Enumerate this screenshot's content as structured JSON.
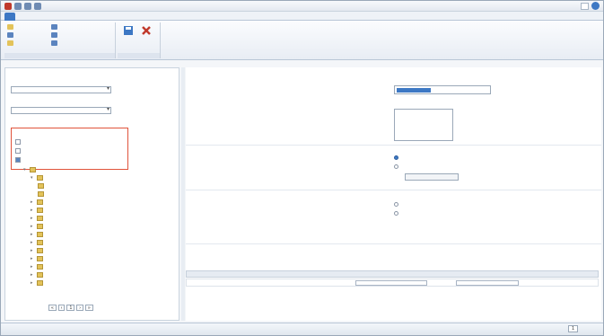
{
  "window": {
    "title": "",
    "user": ""
  },
  "tabs": [
    {
      "label": ""
    },
    {
      "label": ""
    },
    {
      "label": ""
    },
    {
      "label": ""
    },
    {
      "label": ""
    }
  ],
  "ribbon": {
    "group1": {
      "label": "",
      "items": [
        {
          "label": ""
        },
        {
          "label": ""
        },
        {
          "label": ""
        },
        {
          "label": ""
        },
        {
          "label": ""
        },
        {
          "label": ""
        }
      ]
    },
    "group2": {
      "label": "",
      "buttons": [
        {
          "label": ""
        },
        {
          "label": ""
        }
      ]
    }
  },
  "left": {
    "field1_label": "",
    "field1_value": "",
    "field2_label": "",
    "field2_value": "",
    "field2_link": "",
    "options_label": "",
    "options": [
      {
        "label": "",
        "checked": false
      },
      {
        "label": "",
        "checked": false
      },
      {
        "label": "",
        "checked": true
      }
    ],
    "tree": [
      {
        "label": ""
      },
      {
        "label": ""
      },
      {
        "label": ""
      },
      {
        "label": ""
      },
      {
        "label": ""
      },
      {
        "label": ""
      },
      {
        "label": ""
      },
      {
        "label": ""
      },
      {
        "label": ""
      },
      {
        "label": ""
      },
      {
        "label": ""
      },
      {
        "label": ""
      },
      {
        "label": ""
      },
      {
        "label": ""
      },
      {
        "label": ""
      }
    ],
    "pager": {
      "page": "1"
    }
  },
  "right": {
    "section1": {
      "title": "",
      "desc": ""
    },
    "name_label": "",
    "name_value": "",
    "desc_label": "",
    "section2": {
      "title": "",
      "desc": ""
    },
    "section2_radios": [
      {
        "label": "",
        "on": true
      },
      {
        "label": "",
        "on": false
      }
    ],
    "section3": {
      "title": "",
      "desc": ""
    },
    "section3_radios": [
      {
        "label": "",
        "on": true
      },
      {
        "label": "",
        "on": false
      }
    ],
    "section4": {
      "title": "",
      "desc": "",
      "link1": "",
      "link2": ""
    },
    "grid": {
      "headers": [
        "",
        "",
        "",
        "",
        "",
        ""
      ],
      "row": [
        "",
        "",
        "",
        "",
        "",
        ""
      ]
    }
  },
  "status": {
    "left": "",
    "page": "1",
    "right": ""
  },
  "colors": {
    "accent": "#3d78c4",
    "highlight_border": "#e0533b",
    "close_icon": "#c0392b"
  }
}
